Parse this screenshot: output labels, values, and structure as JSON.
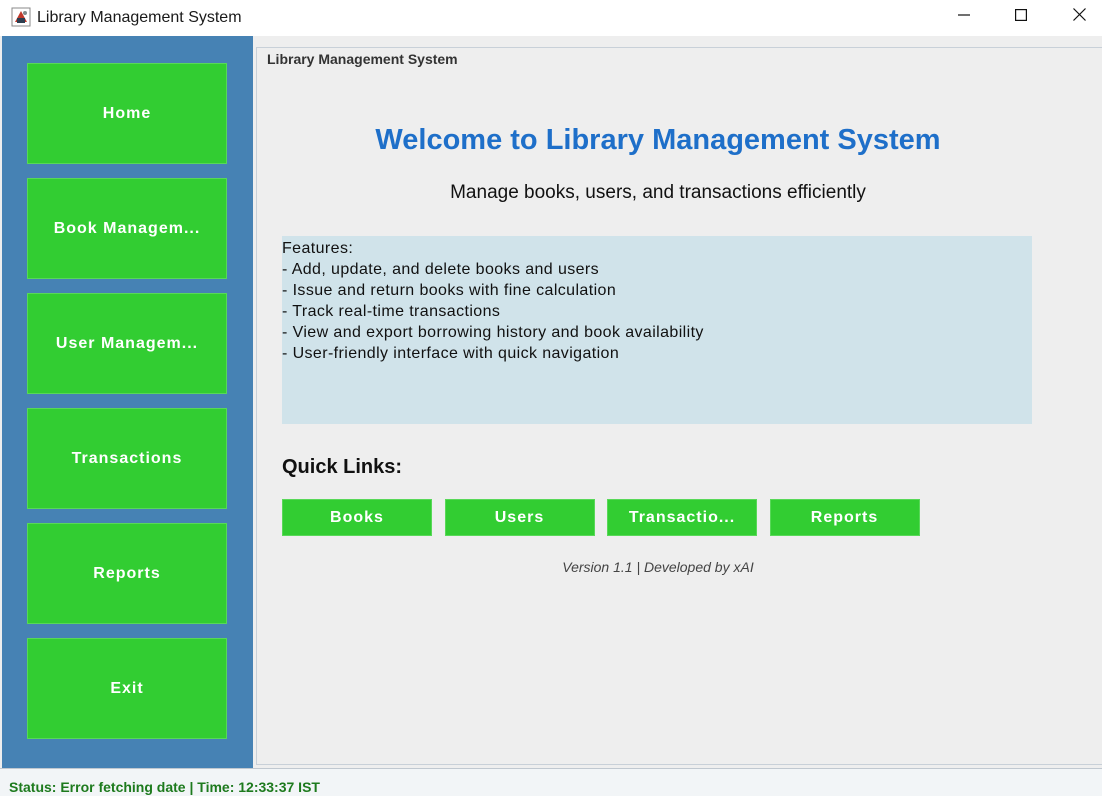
{
  "window": {
    "title": "Library Management System",
    "icons": {
      "app": "library-app-icon",
      "minimize": "minimize-icon",
      "maximize": "maximize-icon",
      "close": "close-icon"
    }
  },
  "sidebar": {
    "items": [
      {
        "label": "Home"
      },
      {
        "label": "Book Managem..."
      },
      {
        "label": "User Managem..."
      },
      {
        "label": "Transactions"
      },
      {
        "label": "Reports"
      },
      {
        "label": "Exit"
      }
    ]
  },
  "main": {
    "group_title": "Library Management System",
    "welcome": "Welcome to Library Management System",
    "subtitle": "Manage books, users, and transactions efficiently",
    "features": [
      "Features:",
      "- Add, update, and delete books and users",
      "- Issue and return books with fine calculation",
      "- Track real-time transactions",
      "- View and export borrowing history and book availability",
      "- User-friendly interface with quick navigation"
    ],
    "quick_links_title": "Quick Links:",
    "quick_links": [
      {
        "label": "Books"
      },
      {
        "label": "Users"
      },
      {
        "label": "Transactio..."
      },
      {
        "label": "Reports"
      }
    ],
    "version": "Version 1.1 | Developed by xAI"
  },
  "status": {
    "text": "Status: Error fetching date | Time: 12:33:37 IST"
  },
  "colors": {
    "sidebar_bg": "#4682b4",
    "button_green": "#32cd32",
    "welcome_blue": "#1e6fc9",
    "features_bg": "#d0e3ea",
    "status_green": "#1d7a1d"
  }
}
